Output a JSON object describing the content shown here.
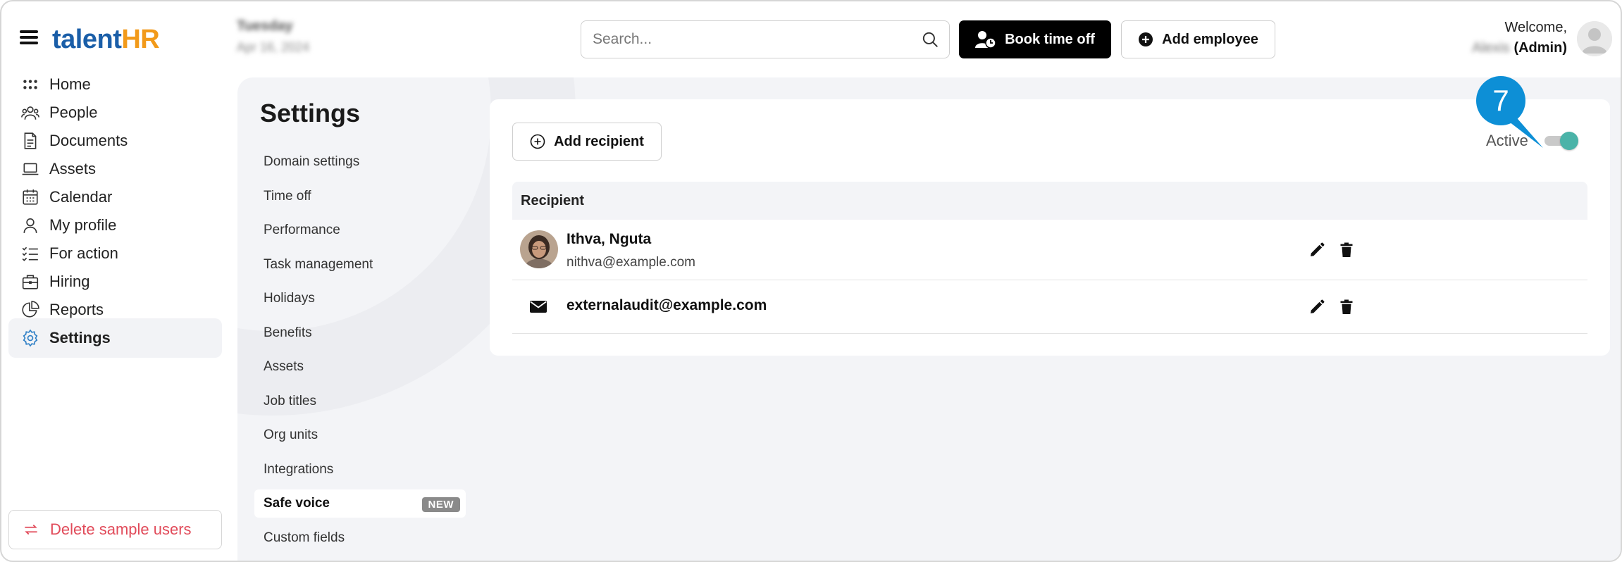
{
  "brand": {
    "logo_part1": "talent",
    "logo_part2": "HR"
  },
  "header": {
    "date_day": "Tuesday",
    "date_full": "Apr 16, 2024",
    "search_placeholder": "Search...",
    "book_time_off_label": "Book time off",
    "add_employee_label": "Add employee",
    "welcome_text": "Welcome,",
    "user_name": "Alexis",
    "user_role": "(Admin)"
  },
  "sidebar": {
    "items": [
      {
        "label": "Home",
        "icon": "grid-icon"
      },
      {
        "label": "People",
        "icon": "people-icon"
      },
      {
        "label": "Documents",
        "icon": "document-icon"
      },
      {
        "label": "Assets",
        "icon": "laptop-icon"
      },
      {
        "label": "Calendar",
        "icon": "calendar-icon"
      },
      {
        "label": "My profile",
        "icon": "user-icon"
      },
      {
        "label": "For action",
        "icon": "checklist-icon"
      },
      {
        "label": "Hiring",
        "icon": "briefcase-icon"
      },
      {
        "label": "Reports",
        "icon": "pie-chart-icon"
      },
      {
        "label": "Settings",
        "icon": "gear-icon",
        "active": true
      }
    ],
    "delete_label": "Delete sample users"
  },
  "settings": {
    "title": "Settings",
    "menu": [
      {
        "label": "Domain settings"
      },
      {
        "label": "Time off"
      },
      {
        "label": "Performance"
      },
      {
        "label": "Task management"
      },
      {
        "label": "Holidays"
      },
      {
        "label": "Benefits"
      },
      {
        "label": "Assets"
      },
      {
        "label": "Job titles"
      },
      {
        "label": "Org units"
      },
      {
        "label": "Integrations"
      },
      {
        "label": "Safe voice",
        "active": true,
        "badge": "NEW"
      },
      {
        "label": "Custom fields"
      }
    ]
  },
  "panel": {
    "add_recipient_label": "Add recipient",
    "active_label": "Active",
    "active_on": true,
    "column_header": "Recipient",
    "recipients": [
      {
        "name": "Ithva, Nguta",
        "email": "nithva@example.com"
      },
      {
        "email": "externalaudit@example.com"
      }
    ]
  },
  "callout": {
    "number": "7"
  },
  "colors": {
    "accent_teal": "#4ab3a8",
    "callout_blue": "#0d8fd6",
    "logo_blue": "#1a5ea8",
    "logo_orange": "#f29a1a",
    "danger": "#e14b5a"
  }
}
